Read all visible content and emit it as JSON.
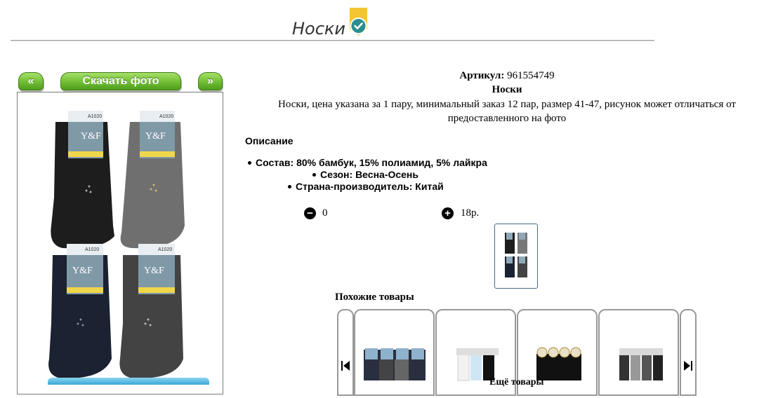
{
  "header": {
    "title": "Носки"
  },
  "gallery": {
    "prev_label": "«",
    "download_label": "Скачать фото",
    "next_label": "»"
  },
  "product": {
    "article_label": "Артикул:",
    "article_value": "961554749",
    "name": "Носки",
    "summary_line1": "Носки, цена указана за 1 пару, минимальный заказ 12 пар, размер 41-47, рисунок может отличаться от",
    "summary_line2": "предоставленного на фото",
    "description_title": "Описание",
    "specs": [
      "Состав: 80% бамбук, 15% полиамид, 5% лайкра",
      "Сезон: Весна-Осень",
      "Страна-производитель: Китай"
    ]
  },
  "cart": {
    "minus_icon": "−",
    "quantity": "0",
    "plus_icon": "+",
    "price": "18р."
  },
  "similar": {
    "title": "Похожие товары",
    "more_title": "Ещё товары"
  },
  "photo": {
    "brand": "Y&F",
    "model": "A1020"
  },
  "colors": {
    "button_green": "#79c43c",
    "badge_yellow": "#f5c431",
    "check_teal": "#2a8d8f"
  }
}
